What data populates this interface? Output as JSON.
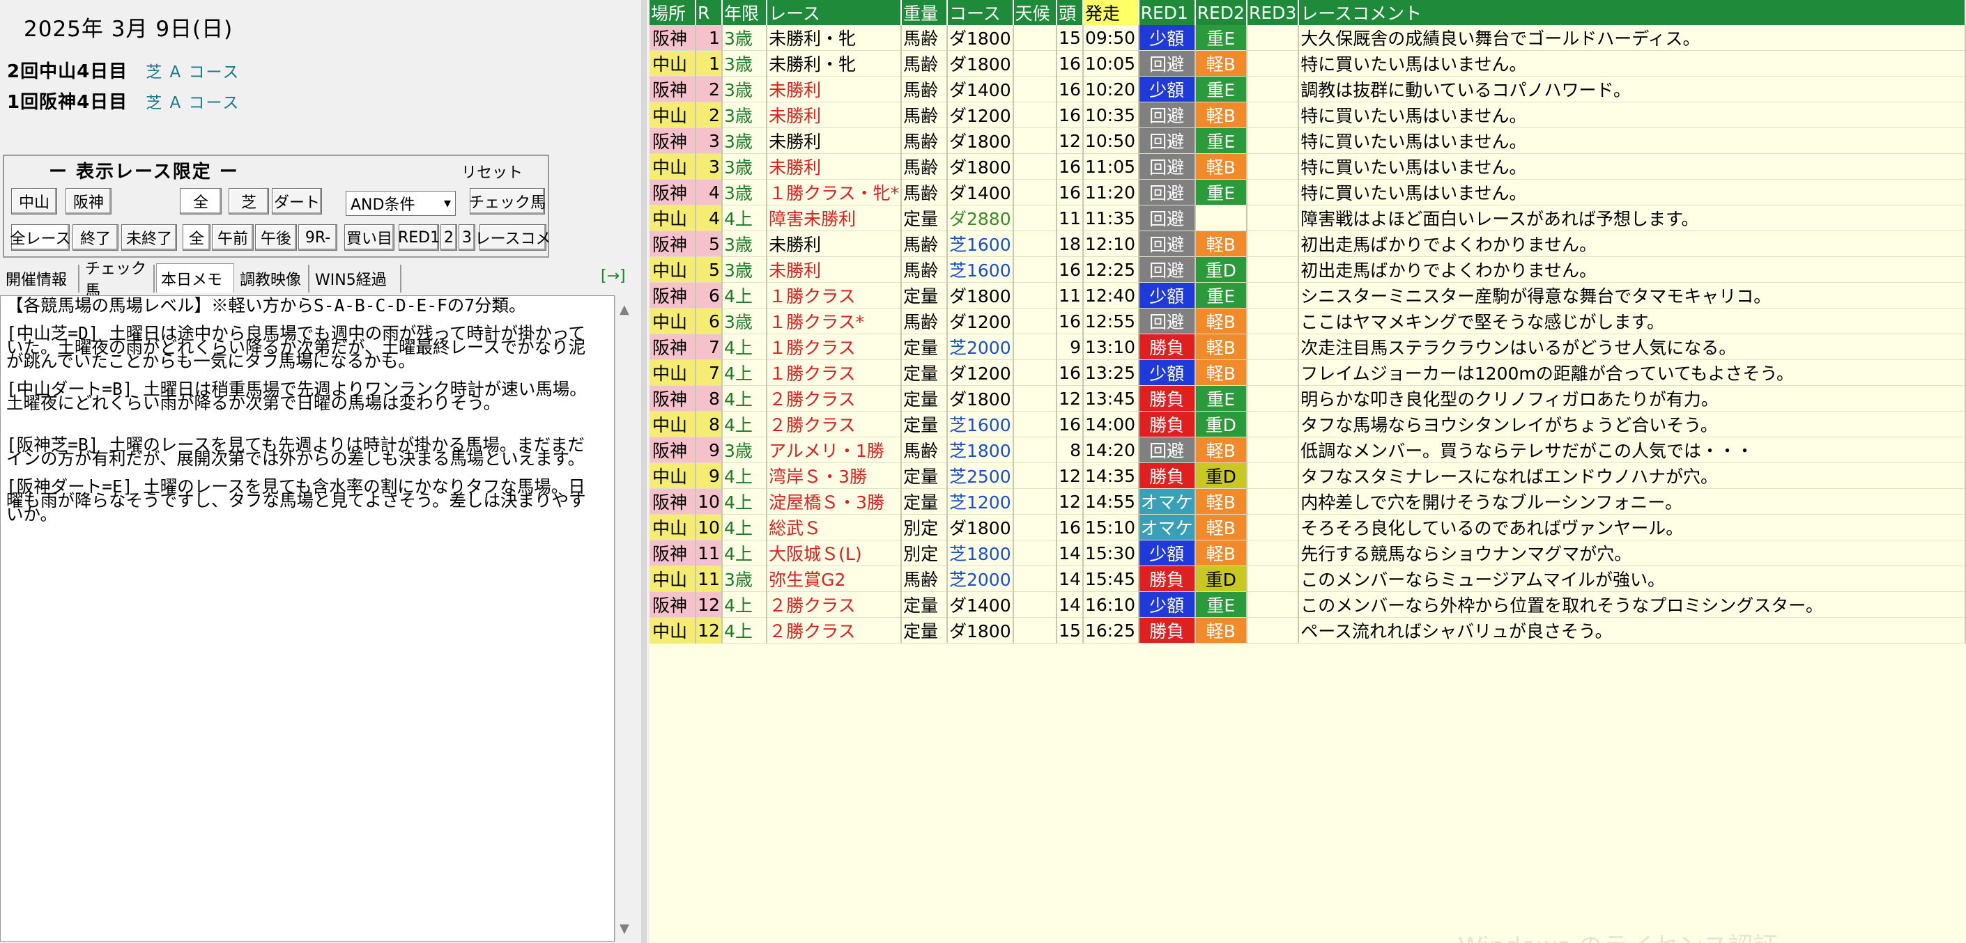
{
  "date": "2025年 3月 9日(日)",
  "meetings": [
    {
      "name": "2回中山4日目",
      "course": "芝 A コース"
    },
    {
      "name": "1回阪神4日目",
      "course": "芝 A コース"
    }
  ],
  "filter": {
    "title": "ー 表示レース限定 ー",
    "reset": "リセット",
    "nakayama": "中山",
    "hanshin": "阪神",
    "all": "全",
    "turf": "芝",
    "dirt": "ダート",
    "condition": "AND条件",
    "check_horse": "チェック馬",
    "all_race": "全レース",
    "finished": "終了",
    "unfinished": "未終了",
    "all2": "全",
    "am": "午前",
    "pm": "午後",
    "r9": "9R-",
    "buy": "買い目",
    "mark1": "RED1",
    "mark2": "2",
    "mark3": "3",
    "race_comment": "レースコメ"
  },
  "tabs": [
    "開催情報",
    "チェック馬",
    "本日メモ",
    "調教映像",
    "WIN5経過"
  ],
  "tab_arrow": "[→]",
  "memo": "【各競馬場の馬場レベル】※軽い方からS-A-B-C-D-E-Fの7分類。\n\n[中山芝=D] 土曜日は途中から良馬場でも週中の雨が残って時計が掛かっていた。土曜夜の雨がどれくらい降るか次第だが、土曜最終レースでかなり泥が跳んでいたことからも一気にタフ馬場になるかも。\n\n[中山ダート=B] 土曜日は稍重馬場で先週よりワンランク時計が速い馬場。土曜夜にどれくらい雨が降るか次第で日曜の馬場は変わりそう。\n\n\n[阪神芝=B] 土曜のレースを見ても先週よりは時計が掛かる馬場。まだまだインの方が有利だが、展開次第では外からの差しも決まる馬場といえます。\n\n[阪神ダート=E] 土曜のレースを見ても含水率の割にかなりタフな馬場。日曜も雨が降らなそうですし、タフな馬場と見てよさそう。差しは決まりやすいか。",
  "columns": [
    "場所",
    "R",
    "年限",
    "レース",
    "重量",
    "コース",
    "天候",
    "頭",
    "発走",
    "RED1",
    "RED2",
    "RED3",
    "レースコメント"
  ],
  "watermark": "Windows のライセンス認証",
  "races": [
    {
      "place": "阪神",
      "r": "1",
      "age": "3歳",
      "race": "未勝利・牝",
      "weight": "馬齢",
      "course": "ダ1800",
      "weather": "",
      "heads": "15",
      "time": "09:50",
      "m1": "少額",
      "m2": "重E",
      "m3": "",
      "comment": "大久保厩舎の成績良い舞台でゴールドハーディス。",
      "race_color": "black",
      "course_color": "black",
      "m1c": "shougaku",
      "m2c": "omoE"
    },
    {
      "place": "中山",
      "r": "1",
      "age": "3歳",
      "race": "未勝利・牝",
      "weight": "馬齢",
      "course": "ダ1800",
      "weather": "",
      "heads": "16",
      "time": "10:05",
      "m1": "回避",
      "m2": "軽B",
      "m3": "",
      "comment": "特に買いたい馬はいません。",
      "race_color": "black",
      "course_color": "black",
      "m1c": "kaihi",
      "m2c": "keiB"
    },
    {
      "place": "阪神",
      "r": "2",
      "age": "3歳",
      "race": "未勝利",
      "weight": "馬齢",
      "course": "ダ1400",
      "weather": "",
      "heads": "16",
      "time": "10:20",
      "m1": "少額",
      "m2": "重E",
      "m3": "",
      "comment": "調教は抜群に動いているコパノハワード。",
      "race_color": "red",
      "course_color": "black",
      "m1c": "shougaku",
      "m2c": "omoE"
    },
    {
      "place": "中山",
      "r": "2",
      "age": "3歳",
      "race": "未勝利",
      "weight": "馬齢",
      "course": "ダ1200",
      "weather": "",
      "heads": "16",
      "time": "10:35",
      "m1": "回避",
      "m2": "軽B",
      "m3": "",
      "comment": "特に買いたい馬はいません。",
      "race_color": "red",
      "course_color": "black",
      "m1c": "kaihi",
      "m2c": "keiB"
    },
    {
      "place": "阪神",
      "r": "3",
      "age": "3歳",
      "race": "未勝利",
      "weight": "馬齢",
      "course": "ダ1800",
      "weather": "",
      "heads": "12",
      "time": "10:50",
      "m1": "回避",
      "m2": "重E",
      "m3": "",
      "comment": "特に買いたい馬はいません。",
      "race_color": "black",
      "course_color": "black",
      "m1c": "kaihi",
      "m2c": "omoE"
    },
    {
      "place": "中山",
      "r": "3",
      "age": "3歳",
      "race": "未勝利",
      "weight": "馬齢",
      "course": "ダ1800",
      "weather": "",
      "heads": "16",
      "time": "11:05",
      "m1": "回避",
      "m2": "軽B",
      "m3": "",
      "comment": "特に買いたい馬はいません。",
      "race_color": "red",
      "course_color": "black",
      "m1c": "kaihi",
      "m2c": "keiB"
    },
    {
      "place": "阪神",
      "r": "4",
      "age": "3歳",
      "race": "１勝クラス・牝*",
      "weight": "馬齢",
      "course": "ダ1400",
      "weather": "",
      "heads": "16",
      "time": "11:20",
      "m1": "回避",
      "m2": "重E",
      "m3": "",
      "comment": "特に買いたい馬はいません。",
      "race_color": "red",
      "course_color": "black",
      "m1c": "kaihi",
      "m2c": "omoE"
    },
    {
      "place": "中山",
      "r": "4",
      "age": "4上",
      "race": "障害未勝利",
      "weight": "定量",
      "course": "ダ2880",
      "weather": "",
      "heads": "11",
      "time": "11:35",
      "m1": "回避",
      "m2": "",
      "m3": "",
      "comment": "障害戦はよほど面白いレースがあれば予想します。",
      "race_color": "red",
      "course_color": "green",
      "m1c": "kaihi",
      "m2c": ""
    },
    {
      "place": "阪神",
      "r": "5",
      "age": "3歳",
      "race": "未勝利",
      "weight": "馬齢",
      "course": "芝1600",
      "weather": "",
      "heads": "18",
      "time": "12:10",
      "m1": "回避",
      "m2": "軽B",
      "m3": "",
      "comment": "初出走馬ばかりでよくわかりません。",
      "race_color": "black",
      "course_color": "blue",
      "m1c": "kaihi",
      "m2c": "keiB"
    },
    {
      "place": "中山",
      "r": "5",
      "age": "3歳",
      "race": "未勝利",
      "weight": "馬齢",
      "course": "芝1600",
      "weather": "",
      "heads": "16",
      "time": "12:25",
      "m1": "回避",
      "m2": "重D",
      "m3": "",
      "comment": "初出走馬ばかりでよくわかりません。",
      "race_color": "red",
      "course_color": "blue",
      "m1c": "kaihi",
      "m2c": "omoE"
    },
    {
      "place": "阪神",
      "r": "6",
      "age": "4上",
      "race": "１勝クラス",
      "weight": "定量",
      "course": "ダ1800",
      "weather": "",
      "heads": "11",
      "time": "12:40",
      "m1": "少額",
      "m2": "重E",
      "m3": "",
      "comment": "シニスターミニスター産駒が得意な舞台でタマモキャリコ。",
      "race_color": "red",
      "course_color": "black",
      "m1c": "shougaku",
      "m2c": "omoE"
    },
    {
      "place": "中山",
      "r": "6",
      "age": "3歳",
      "race": "１勝クラス*",
      "weight": "馬齢",
      "course": "ダ1200",
      "weather": "",
      "heads": "16",
      "time": "12:55",
      "m1": "回避",
      "m2": "軽B",
      "m3": "",
      "comment": "ここはヤマメキングで堅そうな感じがします。",
      "race_color": "red",
      "course_color": "black",
      "m1c": "kaihi",
      "m2c": "keiB"
    },
    {
      "place": "阪神",
      "r": "7",
      "age": "4上",
      "race": "１勝クラス",
      "weight": "定量",
      "course": "芝2000",
      "weather": "",
      "heads": "9",
      "time": "13:10",
      "m1": "勝負",
      "m2": "軽B",
      "m3": "",
      "comment": "次走注目馬ステラクラウンはいるがどうせ人気になる。",
      "race_color": "red",
      "course_color": "blue",
      "m1c": "shoubu",
      "m2c": "keiB"
    },
    {
      "place": "中山",
      "r": "7",
      "age": "4上",
      "race": "１勝クラス",
      "weight": "定量",
      "course": "ダ1200",
      "weather": "",
      "heads": "16",
      "time": "13:25",
      "m1": "少額",
      "m2": "軽B",
      "m3": "",
      "comment": "フレイムジョーカーは1200mの距離が合っていてもよさそう。",
      "race_color": "red",
      "course_color": "black",
      "m1c": "shougaku",
      "m2c": "keiB"
    },
    {
      "place": "阪神",
      "r": "8",
      "age": "4上",
      "race": "２勝クラス",
      "weight": "定量",
      "course": "ダ1800",
      "weather": "",
      "heads": "12",
      "time": "13:45",
      "m1": "勝負",
      "m2": "重E",
      "m3": "",
      "comment": "明らかな叩き良化型のクリノフィガロあたりが有力。",
      "race_color": "red",
      "course_color": "black",
      "m1c": "shoubu",
      "m2c": "omoE"
    },
    {
      "place": "中山",
      "r": "8",
      "age": "4上",
      "race": "２勝クラス",
      "weight": "定量",
      "course": "芝1600",
      "weather": "",
      "heads": "16",
      "time": "14:00",
      "m1": "勝負",
      "m2": "重D",
      "m3": "",
      "comment": "タフな馬場ならヨウシタンレイがちょうど合いそう。",
      "race_color": "red",
      "course_color": "blue",
      "m1c": "shoubu",
      "m2c": "omoE"
    },
    {
      "place": "阪神",
      "r": "9",
      "age": "3歳",
      "race": "アルメリ・1勝",
      "weight": "馬齢",
      "course": "芝1800",
      "weather": "",
      "heads": "8",
      "time": "14:20",
      "m1": "回避",
      "m2": "軽B",
      "m3": "",
      "comment": "低調なメンバー。買うならテレサだがこの人気では・・・",
      "race_color": "red",
      "course_color": "blue",
      "m1c": "kaihi",
      "m2c": "keiB"
    },
    {
      "place": "中山",
      "r": "9",
      "age": "4上",
      "race": "湾岸Ｓ・3勝",
      "weight": "定量",
      "course": "芝2500",
      "weather": "",
      "heads": "12",
      "time": "14:35",
      "m1": "勝負",
      "m2": "重D",
      "m3": "",
      "comment": "タフなスタミナレースになればエンドウノハナが穴。",
      "race_color": "red",
      "course_color": "blue",
      "m1c": "shoubu",
      "m2c": "omoD"
    },
    {
      "place": "阪神",
      "r": "10",
      "age": "4上",
      "race": "淀屋橋Ｓ・3勝",
      "weight": "定量",
      "course": "芝1200",
      "weather": "",
      "heads": "12",
      "time": "14:55",
      "m1": "オマケ",
      "m2": "軽B",
      "m3": "",
      "comment": "内枠差しで穴を開けそうなブルーシンフォニー。",
      "race_color": "red",
      "course_color": "blue",
      "m1c": "omake",
      "m2c": "keiB"
    },
    {
      "place": "中山",
      "r": "10",
      "age": "4上",
      "race": "総武Ｓ",
      "weight": "別定",
      "course": "ダ1800",
      "weather": "",
      "heads": "16",
      "time": "15:10",
      "m1": "オマケ",
      "m2": "軽B",
      "m3": "",
      "comment": "そろそろ良化しているのであればヴァンヤール。",
      "race_color": "red",
      "course_color": "black",
      "m1c": "omake",
      "m2c": "keiB"
    },
    {
      "place": "阪神",
      "r": "11",
      "age": "4上",
      "race": "大阪城Ｓ(L)",
      "weight": "別定",
      "course": "芝1800",
      "weather": "",
      "heads": "14",
      "time": "15:30",
      "m1": "少額",
      "m2": "軽B",
      "m3": "",
      "comment": "先行する競馬ならショウナンマグマが穴。",
      "race_color": "red",
      "course_color": "blue",
      "m1c": "shougaku",
      "m2c": "keiB"
    },
    {
      "place": "中山",
      "r": "11",
      "age": "3歳",
      "race": "弥生賞G2",
      "weight": "馬齢",
      "course": "芝2000",
      "weather": "",
      "heads": "14",
      "time": "15:45",
      "m1": "勝負",
      "m2": "重D",
      "m3": "",
      "comment": "このメンバーならミュージアムマイルが強い。",
      "race_color": "red",
      "course_color": "blue",
      "m1c": "shoubu",
      "m2c": "omoD"
    },
    {
      "place": "阪神",
      "r": "12",
      "age": "4上",
      "race": "２勝クラス",
      "weight": "定量",
      "course": "ダ1400",
      "weather": "",
      "heads": "14",
      "time": "16:10",
      "m1": "少額",
      "m2": "重E",
      "m3": "",
      "comment": "このメンバーなら外枠から位置を取れそうなプロミシングスター。",
      "race_color": "red",
      "course_color": "black",
      "m1c": "shougaku",
      "m2c": "omoE"
    },
    {
      "place": "中山",
      "r": "12",
      "age": "4上",
      "race": "２勝クラス",
      "weight": "定量",
      "course": "ダ1800",
      "weather": "",
      "heads": "15",
      "time": "16:25",
      "m1": "勝負",
      "m2": "軽B",
      "m3": "",
      "comment": "ペース流れればシャバリュが良さそう。",
      "race_color": "red",
      "course_color": "black",
      "m1c": "shoubu",
      "m2c": "keiB"
    }
  ]
}
